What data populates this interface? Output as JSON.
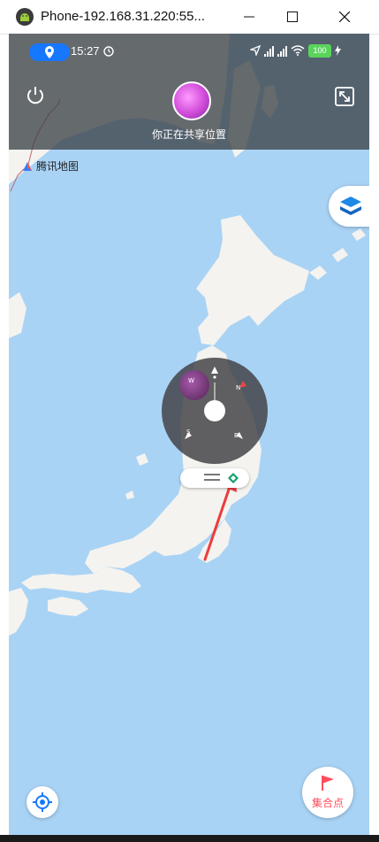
{
  "window": {
    "title": "Phone-192.168.31.220:55..."
  },
  "statusbar": {
    "time": "15:27",
    "battery": "100"
  },
  "header": {
    "share_text": "你正在共享位置"
  },
  "map": {
    "brand": "腾讯地图"
  },
  "compass": {
    "labels": [
      "W",
      "N",
      "S",
      "E"
    ]
  },
  "buttons": {
    "rally": "集合点"
  },
  "icons": {
    "window": [
      "android-icon",
      "minimize-icon",
      "maximize-icon",
      "close-icon"
    ],
    "status": [
      "location-icon",
      "alarm-icon",
      "navigation-arrow-icon",
      "signal-icon",
      "wifi-icon",
      "battery-icon",
      "charging-icon"
    ],
    "map": [
      "power-icon",
      "collapse-icon",
      "tencent-map-logo-icon",
      "layers-icon",
      "locate-icon",
      "flag-icon",
      "location-diamond-icon",
      "menu-lines-icon",
      "red-arrow-annotation"
    ]
  },
  "colors": {
    "accent": "#1677ff",
    "sea": "#a9d3f5",
    "land": "#f4f3ef",
    "rally_text": "#ff4d5e",
    "arrow": "#ee3b3b",
    "battery": "#59d45b"
  }
}
